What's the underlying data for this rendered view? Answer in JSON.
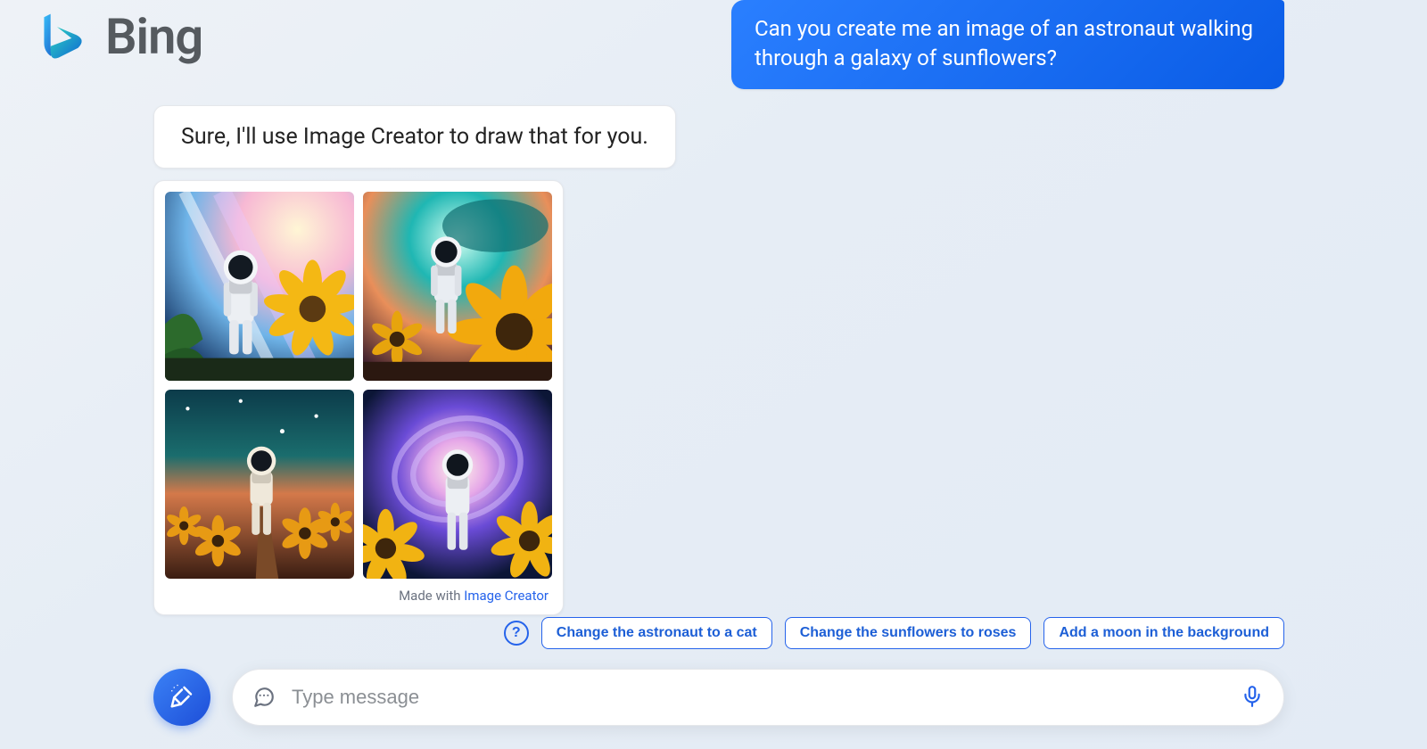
{
  "brand": {
    "name": "Bing"
  },
  "conversation": {
    "user_message": "Can you create me an image of an astronaut walking through a galaxy of sunflowers?",
    "bot_reply": "Sure, I'll use Image Creator to draw that for you."
  },
  "image_card": {
    "caption_prefix": "Made with ",
    "caption_link": "Image Creator",
    "images": [
      {
        "alt": "astronaut-sunflower-galaxy-1"
      },
      {
        "alt": "astronaut-sunflower-galaxy-2"
      },
      {
        "alt": "astronaut-sunflower-galaxy-3"
      },
      {
        "alt": "astronaut-sunflower-galaxy-4"
      }
    ]
  },
  "suggestions": {
    "help_label": "?",
    "chips": [
      "Change the astronaut to a cat",
      "Change the sunflowers to roses",
      "Add a moon in the background"
    ]
  },
  "composer": {
    "placeholder": "Type message"
  }
}
